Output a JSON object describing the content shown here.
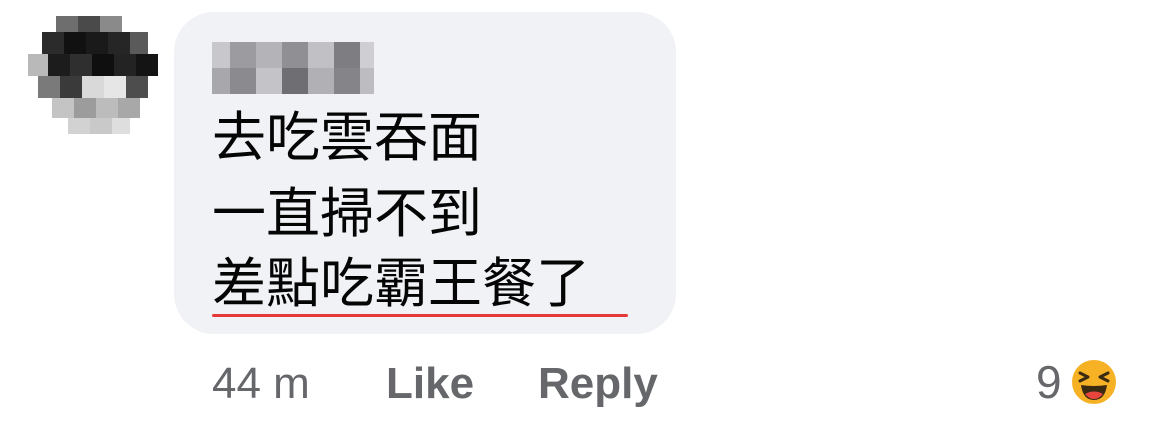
{
  "comment": {
    "author_name": "",
    "lines": [
      "去吃雲吞面",
      "一直掃不到",
      "差點吃霸王餐了"
    ],
    "timestamp": "44 m",
    "like_label": "Like",
    "reply_label": "Reply",
    "reaction_count": "9",
    "reaction_icon": "haha-emoji-icon"
  },
  "colors": {
    "bubble": "#f0f2f5",
    "text": "#050505",
    "meta": "#65676b",
    "underline": "#e53935",
    "emoji": "#f7b125"
  }
}
